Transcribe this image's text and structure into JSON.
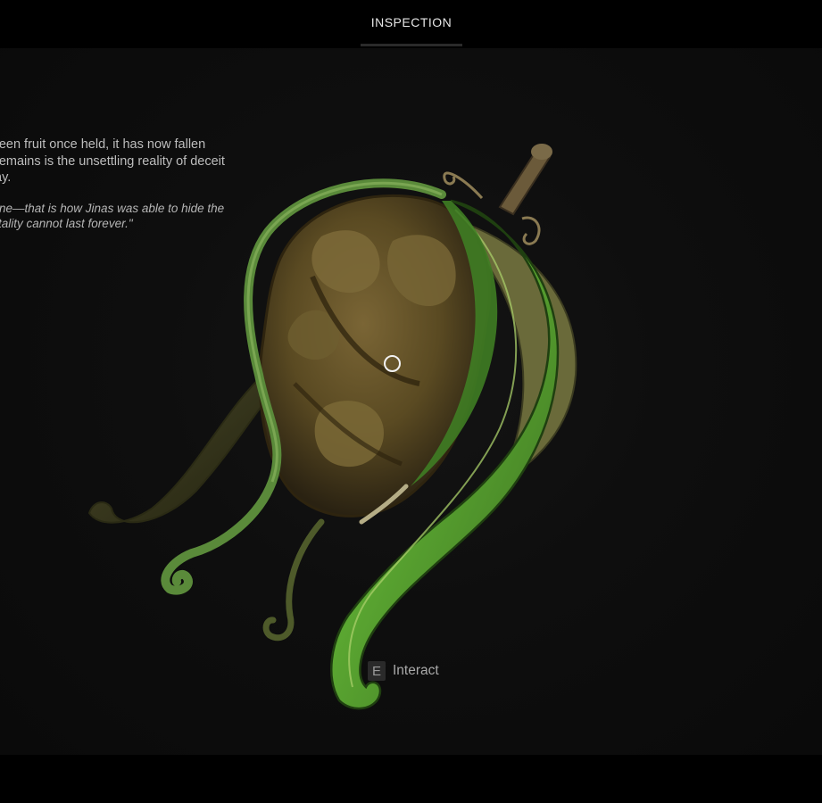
{
  "header": {
    "tab_label": "INSPECTION"
  },
  "lore": {
    "description_lines": [
      "reen fruit once held, it has now fallen",
      "remains is the unsettling reality of deceit",
      "ay."
    ],
    "quote_lines": [
      "ine—that is how Jinas was able to hide the",
      "tality cannot last forever.\""
    ]
  },
  "object": {
    "icon": "decayed-fruit-with-leaves",
    "colors": {
      "fruit": "#5a4a22",
      "leaf": "#4f9a2c",
      "stem": "#6b5a3a"
    }
  },
  "prompt": {
    "key": "E",
    "label": "Interact"
  }
}
